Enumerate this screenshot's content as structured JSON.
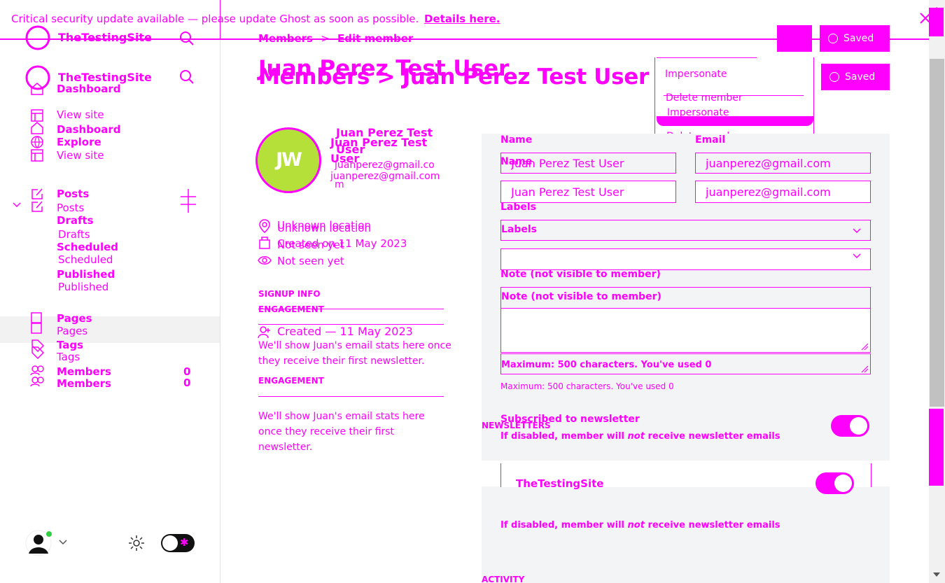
{
  "banner": {
    "text": "Critical security update available — please update Ghost as soon as possible.",
    "link": "Details here."
  },
  "site": {
    "name": "TheTestingSite"
  },
  "breadcrumb": {
    "parent": "Members",
    "sep": ">",
    "current": "Edit member"
  },
  "page_title": "Juan Perez Test User",
  "page_title_ghost": "Members > Juan Perez Test User",
  "nav": {
    "dashboard": "Dashboard",
    "view_site": "View site",
    "explore": "Explore",
    "posts": "Posts",
    "drafts": "Drafts",
    "scheduled": "Scheduled",
    "published": "Published",
    "pages": "Pages",
    "tags": "Tags",
    "members": "Members",
    "members_count": "0"
  },
  "actions": {
    "saved": "Saved",
    "impersonate": "Impersonate",
    "delete_member": "Delete member"
  },
  "member": {
    "initials": "JW",
    "name": "Juan Perez Test User",
    "name_line1": "Juan Perez Test",
    "name_line2": "User",
    "email": "juanperez@gmail.com",
    "email_wrap1": "juanperez@gmail.co",
    "email_wrap2": "m",
    "location": "Unknown location",
    "created": "Created on 11 May 2023",
    "seen": "Not seen yet"
  },
  "signup": {
    "header": "SIGNUP INFO",
    "created": "Created — 11 May 2023"
  },
  "engagement": {
    "header": "ENGAGEMENT",
    "text": "We'll show Juan's email stats here once they receive their first newsletter.",
    "text_wrap1": "We'll show Juan's email stats here once",
    "text_wrap2": "they receive their first newsletter.",
    "text2_l1": "We'll show Juan's email stats here",
    "text2_l2": "once they receive their first",
    "text2_l3": "newsletter."
  },
  "form": {
    "name_label": "Name",
    "email_label": "Email",
    "name_value": "Juan Perez Test User",
    "email_value": "juanperez@gmail.com",
    "labels_label": "Labels",
    "note_label": "Note (not visible to member)",
    "note_hint": "Maximum: 500 characters. You've used 0",
    "subscribed_title": "Subscribed to newsletter",
    "subscribed_hint_pre": "If disabled, member will ",
    "subscribed_hint_em": "not",
    "subscribed_hint_post": " receive newsletter emails"
  },
  "newsletters": {
    "header": "NEWSLETTERS",
    "item": "TheTestingSite"
  },
  "activity": {
    "header": "ACTIVITY"
  },
  "colors": {
    "accent": "#ff00ff",
    "avatar_bg": "#b5e03a",
    "online": "#30cf43",
    "panel": "#f3f4f5"
  }
}
